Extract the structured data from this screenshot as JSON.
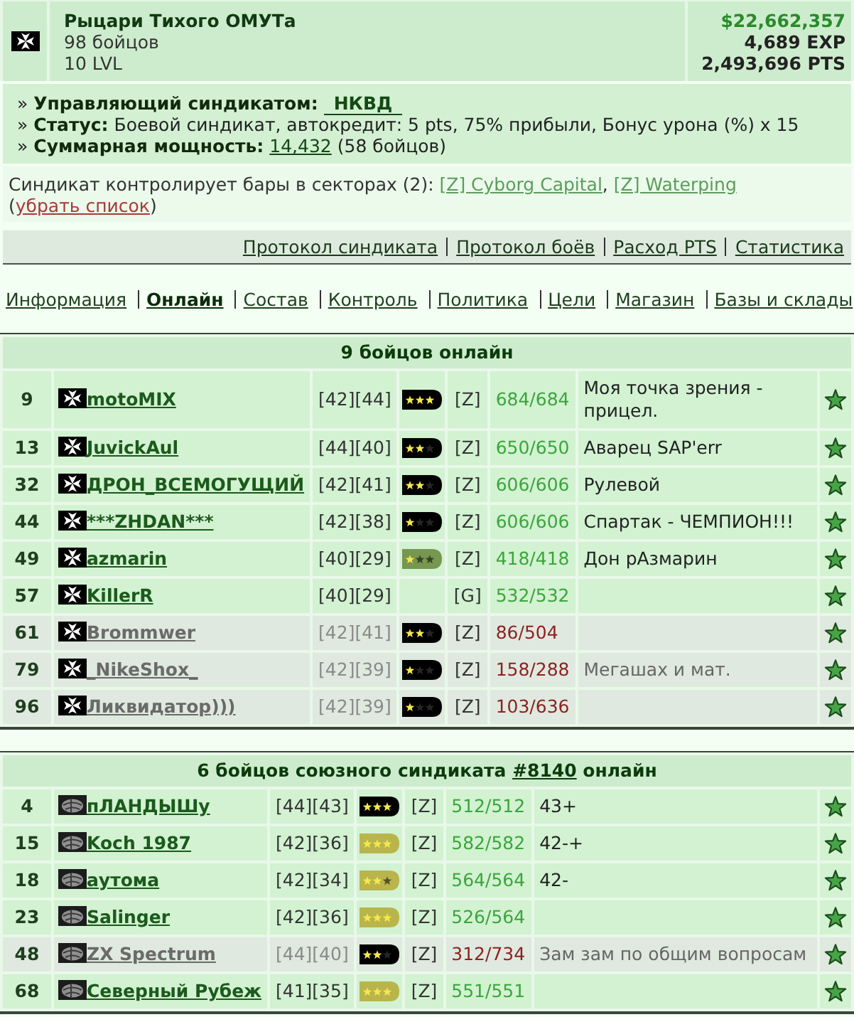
{
  "syndicate": {
    "name": "Рыцари Тихого ОМУТа",
    "members": "98 бойцов",
    "level": "10 LVL",
    "money": "$22,662,357",
    "exp": "4,689 EXP",
    "pts": "2,493,696 PTS"
  },
  "info_lines": [
    {
      "bullet": "»",
      "label": "Управляющий синдикатом:",
      "link": "НКВД"
    },
    {
      "bullet": "»",
      "label": "Статус:",
      "text": "Боевой синдикат, автокредит: 5 pts, 75% прибыли, Бонус урона (%) x 15"
    },
    {
      "bullet": "»",
      "label": "Суммарная мощность:",
      "link": "14,432",
      "text": "(58 бойцов)"
    }
  ],
  "sectors": [
    {
      "kind": "text",
      "text": "Синдикат контролирует бары в секторах (2): "
    },
    {
      "kind": "sector",
      "text": "[Z] Cyborg Capital"
    },
    {
      "kind": "text",
      "text": ", "
    },
    {
      "kind": "sector",
      "text": "[Z] Waterping"
    },
    {
      "kind": "text",
      "text": " ("
    },
    {
      "kind": "action",
      "text": "убрать список"
    },
    {
      "kind": "text",
      "text": ")"
    }
  ],
  "protocol_links": [
    "Протокол синдиката",
    "Протокол боёв",
    "Расход PTS",
    "Статистика"
  ],
  "tabs": [
    {
      "label": "Информация",
      "selected": false
    },
    {
      "label": "Онлайн",
      "selected": true
    },
    {
      "label": "Состав",
      "selected": false
    },
    {
      "label": "Контроль",
      "selected": false
    },
    {
      "label": "Политика",
      "selected": false
    },
    {
      "label": "Цели",
      "selected": false
    },
    {
      "label": "Магазин",
      "selected": false
    },
    {
      "label": "Базы и склады",
      "selected": false
    }
  ],
  "tables": [
    {
      "kind": "own",
      "title": [
        {
          "kind": "text",
          "text": "9 бойцов онлайн"
        }
      ],
      "rows": [
        {
          "number": "9",
          "name": "motoMIX",
          "level": "[42][44]",
          "rank": {
            "color": "#000000",
            "stars": 3
          },
          "side": "[Z]",
          "hp": "684/684",
          "note": "Моя точка зрения - прицел.",
          "inactive": false
        },
        {
          "number": "13",
          "name": "JuvickAul",
          "level": "[44][40]",
          "rank": {
            "color": "#000000",
            "stars": 2
          },
          "side": "[Z]",
          "hp": "650/650",
          "note": "Аварец SAP'err",
          "inactive": false
        },
        {
          "number": "32",
          "name": "ДРОН_ВСЕМОГУЩИЙ",
          "level": "[42][41]",
          "rank": {
            "color": "#000000",
            "stars": 2
          },
          "side": "[Z]",
          "hp": "606/606",
          "note": "Рулевой",
          "inactive": false
        },
        {
          "number": "44",
          "name": "***ZHDAN***",
          "level": "[42][38]",
          "rank": {
            "color": "#000000",
            "stars": 1
          },
          "side": "[Z]",
          "hp": "606/606",
          "note": "Спартак - ЧЕМПИОН!!!",
          "inactive": false
        },
        {
          "number": "49",
          "name": "azmarin",
          "level": "[40][29]",
          "rank": {
            "color": "#779650",
            "stars": 1
          },
          "side": "[Z]",
          "hp": "418/418",
          "note": "Дон рАзмарин",
          "inactive": false
        },
        {
          "number": "57",
          "name": "KillerR",
          "level": "[40][29]",
          "side": "[G]",
          "hp": "532/532",
          "inactive": false
        },
        {
          "number": "61",
          "name": "Brommwer",
          "level": "[42][41]",
          "rank": {
            "color": "#000000",
            "stars": 2
          },
          "side": "[Z]",
          "hp": "86/504",
          "inactive": true
        },
        {
          "number": "79",
          "name": "_NikeShox_",
          "level": "[42][39]",
          "rank": {
            "color": "#000000",
            "stars": 1
          },
          "side": "[Z]",
          "hp": "158/288",
          "note": "Мегашах и мат.",
          "inactive": true
        },
        {
          "number": "96",
          "name": "Ликвидатор)))",
          "level": "[42][39]",
          "rank": {
            "color": "#000000",
            "stars": 1
          },
          "side": "[Z]",
          "hp": "103/636",
          "inactive": true
        }
      ]
    },
    {
      "kind": "ally",
      "title": [
        {
          "kind": "text",
          "text": "6 бойцов союзного синдиката "
        },
        {
          "kind": "link",
          "text": "#8140"
        },
        {
          "kind": "text",
          "text": " онлайн"
        }
      ],
      "rows": [
        {
          "number": "4",
          "name": "пЛАНДЫШу",
          "level": "[44][43]",
          "rank": {
            "color": "#000000",
            "stars": 3
          },
          "side": "[Z]",
          "hp": "512/512",
          "note": "43+",
          "inactive": false
        },
        {
          "number": "15",
          "name": "Koch 1987",
          "level": "[42][36]",
          "rank": {
            "color": "#b9b54c",
            "stars": 3
          },
          "side": "[Z]",
          "hp": "582/582",
          "note": "42-+",
          "inactive": false
        },
        {
          "number": "18",
          "name": "аутома",
          "level": "[42][34]",
          "rank": {
            "color": "#b9b54c",
            "stars": 2
          },
          "side": "[Z]",
          "hp": "564/564",
          "note": "42-",
          "inactive": false
        },
        {
          "number": "23",
          "name": "Salinger",
          "level": "[42][36]",
          "rank": {
            "color": "#b9b54c",
            "stars": 3
          },
          "side": "[Z]",
          "hp": "526/564",
          "inactive": false
        },
        {
          "number": "48",
          "name": "ZX Spectrum",
          "level": "[44][40]",
          "rank": {
            "color": "#000000",
            "stars": 2
          },
          "side": "[Z]",
          "hp": "312/734",
          "note": "Зам зам по общим вопросам",
          "inactive": true
        },
        {
          "number": "68",
          "name": "Северный Рубеж",
          "level": "[41][35]",
          "rank": {
            "color": "#b9b54c",
            "stars": 3
          },
          "side": "[Z]",
          "hp": "551/551",
          "inactive": false
        }
      ]
    }
  ]
}
